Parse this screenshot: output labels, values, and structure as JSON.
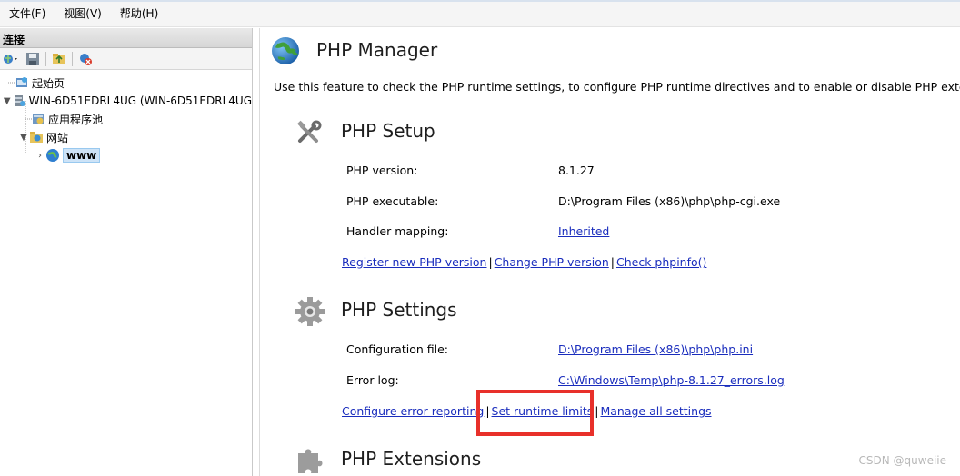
{
  "menu": [
    "文件(F)",
    "视图(V)",
    "帮助(H)"
  ],
  "left": {
    "header": "连接",
    "tree": [
      {
        "label": "起始页"
      },
      {
        "label": "WIN-6D51EDRL4UG (WIN-6D51EDRL4UG"
      },
      {
        "label": "应用程序池"
      },
      {
        "label": "网站"
      },
      {
        "label": "www"
      }
    ]
  },
  "main": {
    "title": "PHP Manager",
    "description": "Use this feature to check the PHP runtime settings, to configure PHP runtime directives and to enable or disable PHP extensions.",
    "setup": {
      "title": "PHP Setup",
      "rows": [
        {
          "label": "PHP version:",
          "value": "8.1.27"
        },
        {
          "label": "PHP executable:",
          "value": "D:\\Program Files (x86)\\php\\php-cgi.exe"
        },
        {
          "label": "Handler mapping:",
          "value": "Inherited"
        }
      ],
      "links": [
        "Register new PHP version",
        "Change PHP version",
        "Check phpinfo()"
      ]
    },
    "settings": {
      "title": "PHP Settings",
      "rows": [
        {
          "label": "Configuration file:",
          "value": "D:\\Program Files (x86)\\php\\php.ini"
        },
        {
          "label": "Error log:",
          "value": "C:\\Windows\\Temp\\php-8.1.27_errors.log"
        }
      ],
      "links": [
        "Configure error reporting",
        "Set runtime limits",
        "Manage all settings"
      ]
    },
    "extensions": {
      "title": "PHP Extensions"
    }
  },
  "watermark": "CSDN @quweiie",
  "colors": {
    "link": "#1a2dbd",
    "highlight": "#e8302a",
    "selection": "#cde3f7"
  }
}
